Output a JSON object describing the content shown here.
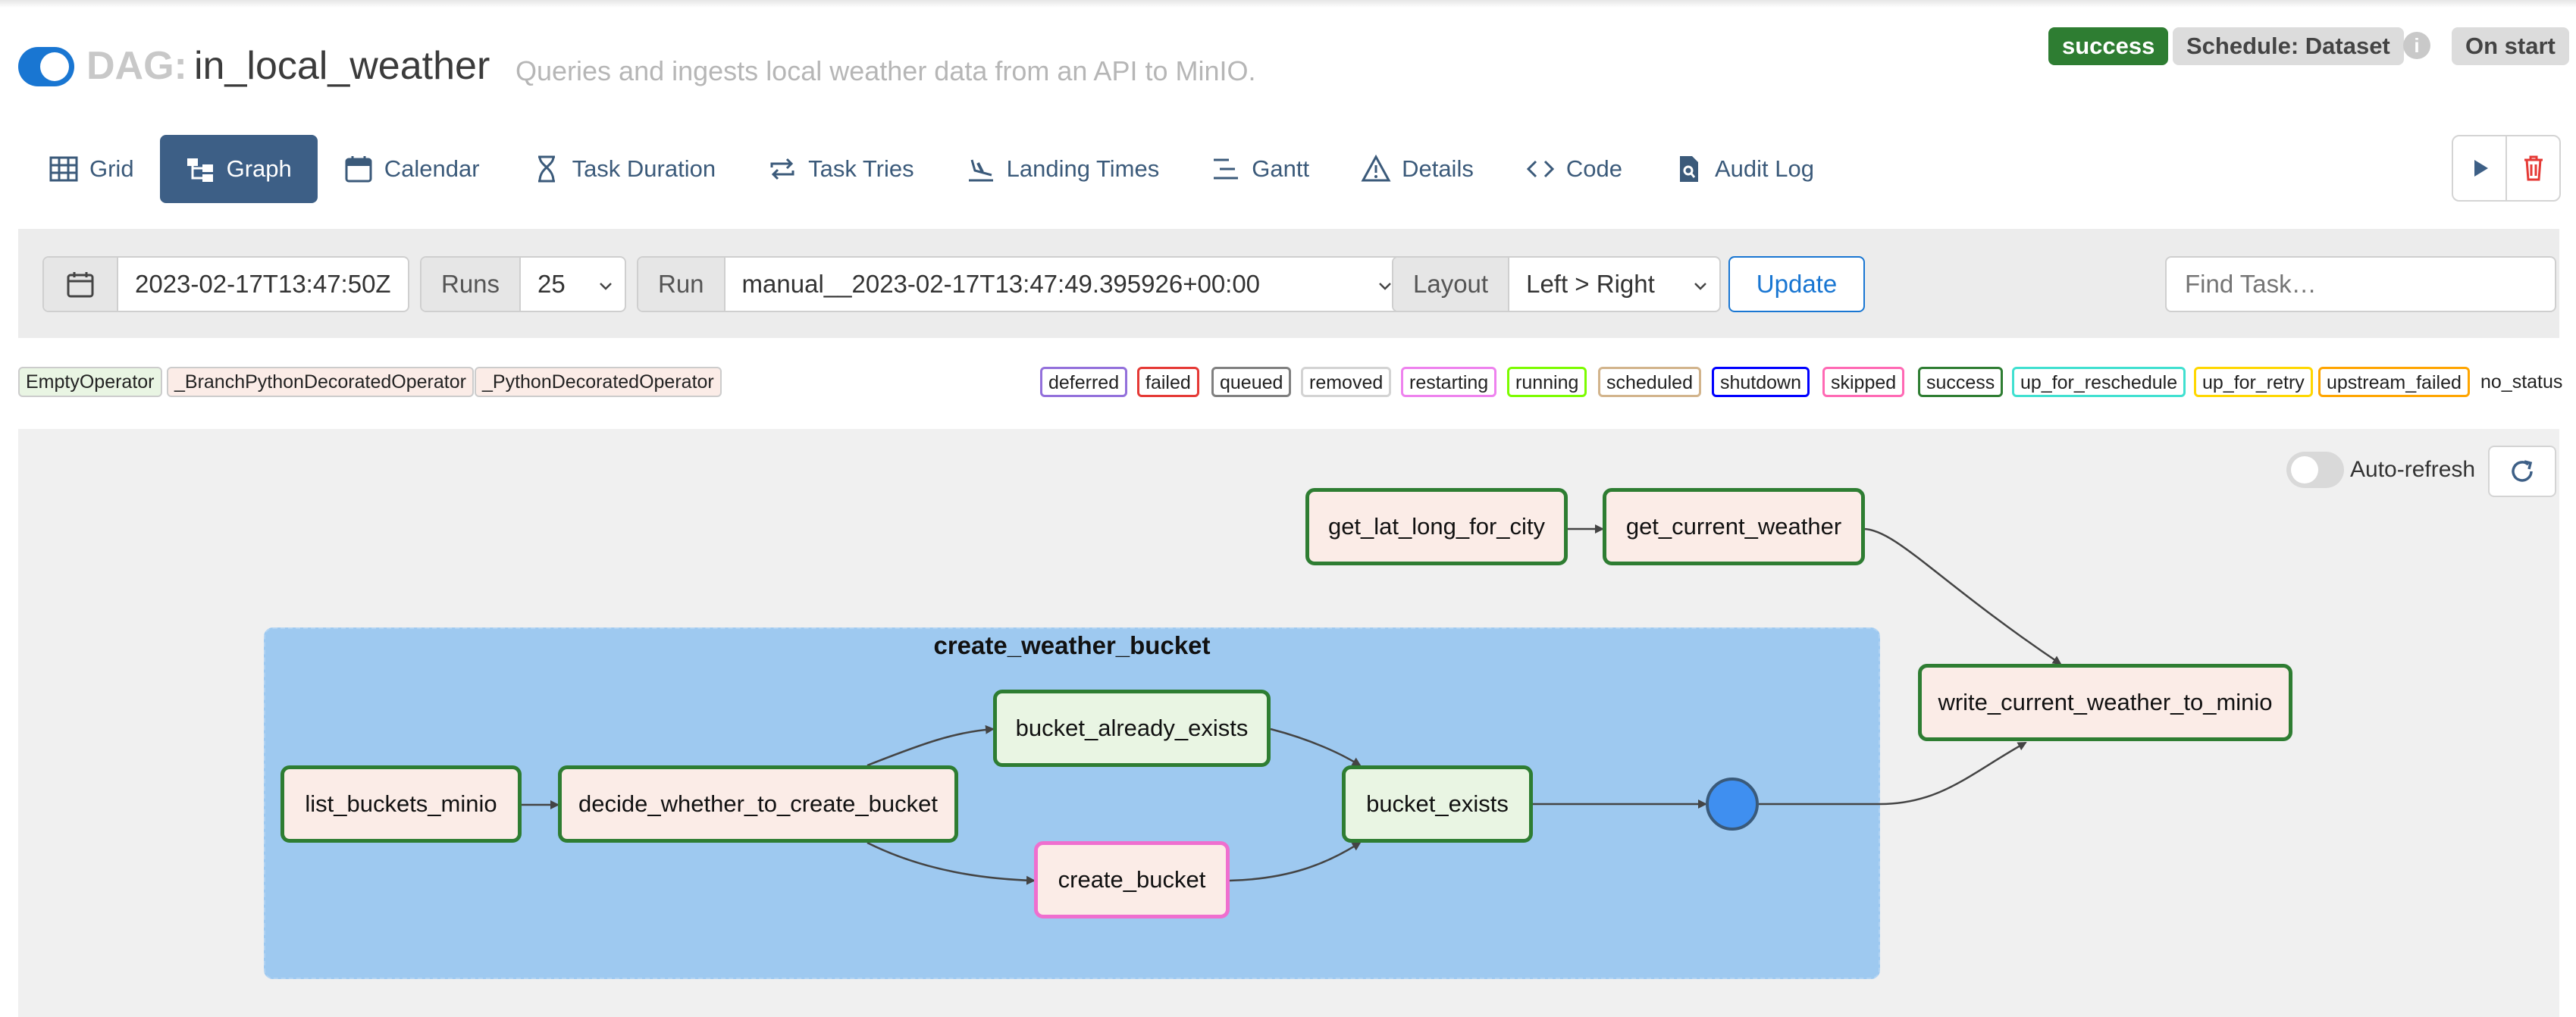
{
  "header": {
    "dag_prefix": "DAG:",
    "dag_id": "in_local_weather",
    "description": "Queries and ingests local weather data from an API to MinIO.",
    "status_badge": "success",
    "schedule_badge": "Schedule: Dataset",
    "info_icon": "i",
    "on_start_badge": "On start"
  },
  "nav": {
    "tabs": [
      {
        "label": "Grid",
        "icon": "grid-icon"
      },
      {
        "label": "Graph",
        "icon": "graph-icon",
        "active": true
      },
      {
        "label": "Calendar",
        "icon": "calendar-icon"
      },
      {
        "label": "Task Duration",
        "icon": "hourglass-icon"
      },
      {
        "label": "Task Tries",
        "icon": "repeat-icon"
      },
      {
        "label": "Landing Times",
        "icon": "plane-landing-icon"
      },
      {
        "label": "Gantt",
        "icon": "gantt-icon"
      },
      {
        "label": "Details",
        "icon": "warning-triangle-icon"
      },
      {
        "label": "Code",
        "icon": "code-icon"
      },
      {
        "label": "Audit Log",
        "icon": "file-search-icon"
      }
    ]
  },
  "filters": {
    "date_value": "2023-02-17T13:47:50Z",
    "runs_label": "Runs",
    "runs_value": "25",
    "run_label": "Run",
    "run_value": "manual__2023-02-17T13:47:49.395926+00:00",
    "layout_label": "Layout",
    "layout_value": "Left > Right",
    "update_label": "Update",
    "find_placeholder": "Find Task…"
  },
  "legend": {
    "operators": [
      {
        "label": "EmptyOperator",
        "bg": "#e9f5e3"
      },
      {
        "label": "_BranchPythonDecoratedOperator",
        "bg": "#fbece7"
      },
      {
        "label": "_PythonDecoratedOperator",
        "bg": "#fbece7"
      }
    ],
    "states": [
      {
        "label": "deferred",
        "color": "#9370db"
      },
      {
        "label": "failed",
        "color": "#e53935"
      },
      {
        "label": "queued",
        "color": "#808080"
      },
      {
        "label": "removed",
        "color": "#d3d3d3"
      },
      {
        "label": "restarting",
        "color": "#ee82ee"
      },
      {
        "label": "running",
        "color": "#7cfc00"
      },
      {
        "label": "scheduled",
        "color": "#d2b48c"
      },
      {
        "label": "shutdown",
        "color": "#0000ff"
      },
      {
        "label": "skipped",
        "color": "#ff69b4"
      },
      {
        "label": "success",
        "color": "#2e7d32"
      },
      {
        "label": "up_for_reschedule",
        "color": "#40e0d0"
      },
      {
        "label": "up_for_retry",
        "color": "#ffd700"
      },
      {
        "label": "upstream_failed",
        "color": "#ffa500"
      }
    ],
    "no_status": "no_status"
  },
  "graph": {
    "auto_refresh_label": "Auto-refresh",
    "group_label": "create_weather_bucket",
    "nodes": {
      "get_lat_long_for_city": "get_lat_long_for_city",
      "get_current_weather": "get_current_weather",
      "write_current_weather_to_minio": "write_current_weather_to_minio",
      "list_buckets_minio": "list_buckets_minio",
      "decide_whether_to_create_bucket": "decide_whether_to_create_bucket",
      "bucket_already_exists": "bucket_already_exists",
      "create_bucket": "create_bucket",
      "bucket_exists": "bucket_exists"
    }
  }
}
